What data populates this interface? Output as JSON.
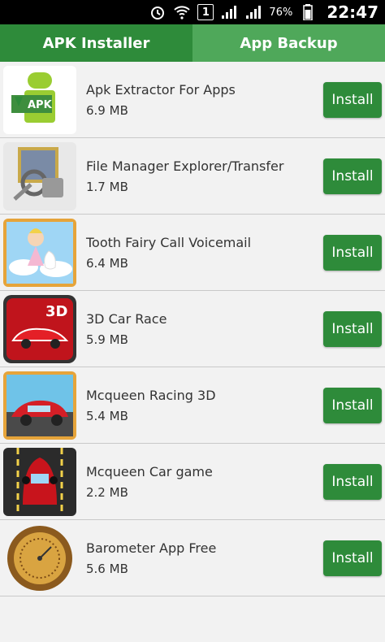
{
  "status_bar": {
    "battery_percent": "76%",
    "time": "22:47",
    "notification_badge": "1",
    "icons": [
      "alarm-icon",
      "wifi-icon",
      "notification-icon",
      "signal-icon",
      "signal-icon",
      "battery-icon"
    ]
  },
  "tabs": [
    {
      "label": "APK Installer",
      "active": true
    },
    {
      "label": "App Backup",
      "active": false
    }
  ],
  "apps": [
    {
      "name": "Apk Extractor For Apps",
      "size": "6.9 MB",
      "button": "Install",
      "icon": "apk-extractor-icon"
    },
    {
      "name": "File Manager Explorer/Transfer",
      "size": "1.7 MB",
      "button": "Install",
      "icon": "file-manager-icon"
    },
    {
      "name": "Tooth Fairy Call Voicemail",
      "size": "6.4 MB",
      "button": "Install",
      "icon": "tooth-fairy-icon"
    },
    {
      "name": "3D Car Race",
      "size": "5.9 MB",
      "button": "Install",
      "icon": "car-race-icon",
      "icon_text": "3D"
    },
    {
      "name": "Mcqueen Racing 3D",
      "size": "5.4 MB",
      "button": "Install",
      "icon": "mcqueen-racing-icon"
    },
    {
      "name": "Mcqueen Car game",
      "size": "2.2 MB",
      "button": "Install",
      "icon": "mcqueen-car-icon"
    },
    {
      "name": "Barometer App Free",
      "size": "5.6 MB",
      "button": "Install",
      "icon": "barometer-icon"
    }
  ],
  "colors": {
    "primary": "#2e8b3a",
    "tab_inactive": "#4fa85a",
    "background": "#f2f2f2"
  }
}
